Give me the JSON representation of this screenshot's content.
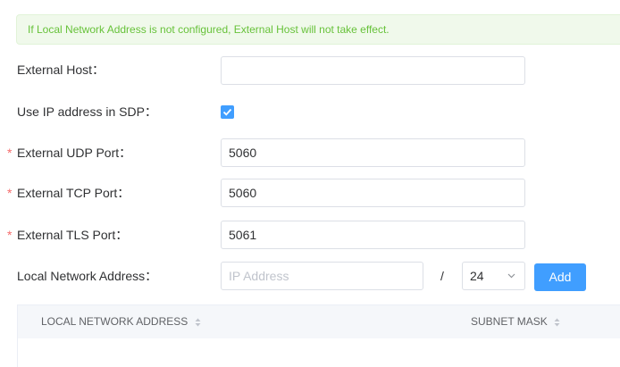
{
  "notice": "If Local Network Address is not configured, External Host will not take effect.",
  "form": {
    "external_host": {
      "label": "External Host：",
      "value": ""
    },
    "use_ip_in_sdp": {
      "label": "Use IP address in SDP：",
      "checked": true
    },
    "udp_port": {
      "required_mark": "*",
      "label": "External UDP Port：",
      "value": "5060"
    },
    "tcp_port": {
      "required_mark": "*",
      "label": "External TCP Port：",
      "value": "5060"
    },
    "tls_port": {
      "required_mark": "*",
      "label": "External TLS Port：",
      "value": "5061"
    },
    "local_network": {
      "label": "Local Network Address：",
      "ip_placeholder": "IP Address",
      "separator": "/",
      "mask_value": "24",
      "add_label": "Add"
    }
  },
  "table": {
    "columns": [
      "LOCAL NETWORK ADDRESS",
      "SUBNET MASK"
    ],
    "rows": []
  },
  "colors": {
    "primary": "#409eff",
    "success_text": "#67c23a",
    "required": "#f56c6c"
  }
}
